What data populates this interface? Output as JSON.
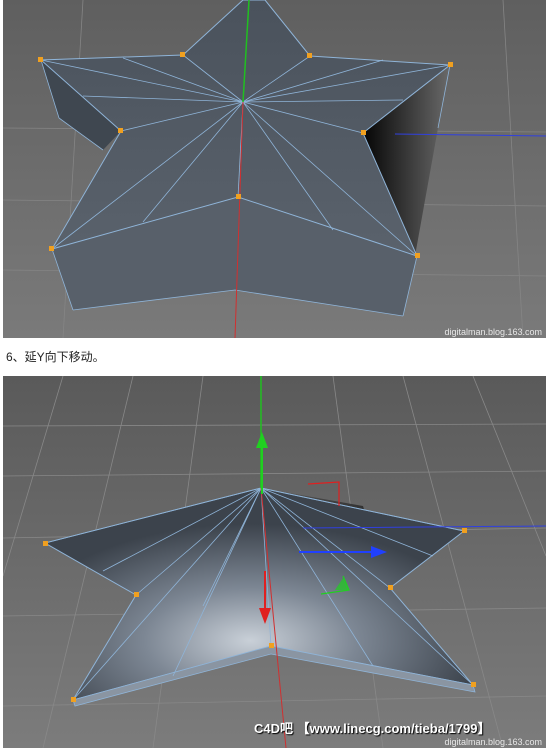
{
  "viewport_top": {
    "watermark": "digitalman.blog.163.com"
  },
  "step": {
    "caption": "6、延Y向下移动。"
  },
  "viewport_bottom": {
    "banner": "C4D吧 【www.linecg.com/tieba/1799】",
    "watermark": "digitalman.blog.163.com"
  },
  "colors": {
    "viewport_bg": "#6b6b6b",
    "grid": "#8a8a8a",
    "mesh_face": "#4c5560",
    "mesh_edge": "#8fb4d8",
    "vertex": "#f0a020",
    "axis_x": "#d03030",
    "axis_y": "#20c020",
    "axis_z": "#3040e0"
  },
  "icons": {
    "axis_arrow_y": "green-arrow-icon",
    "axis_arrow_x": "blue-arrow-icon",
    "axis_arrow_z": "red-arrow-icon"
  }
}
